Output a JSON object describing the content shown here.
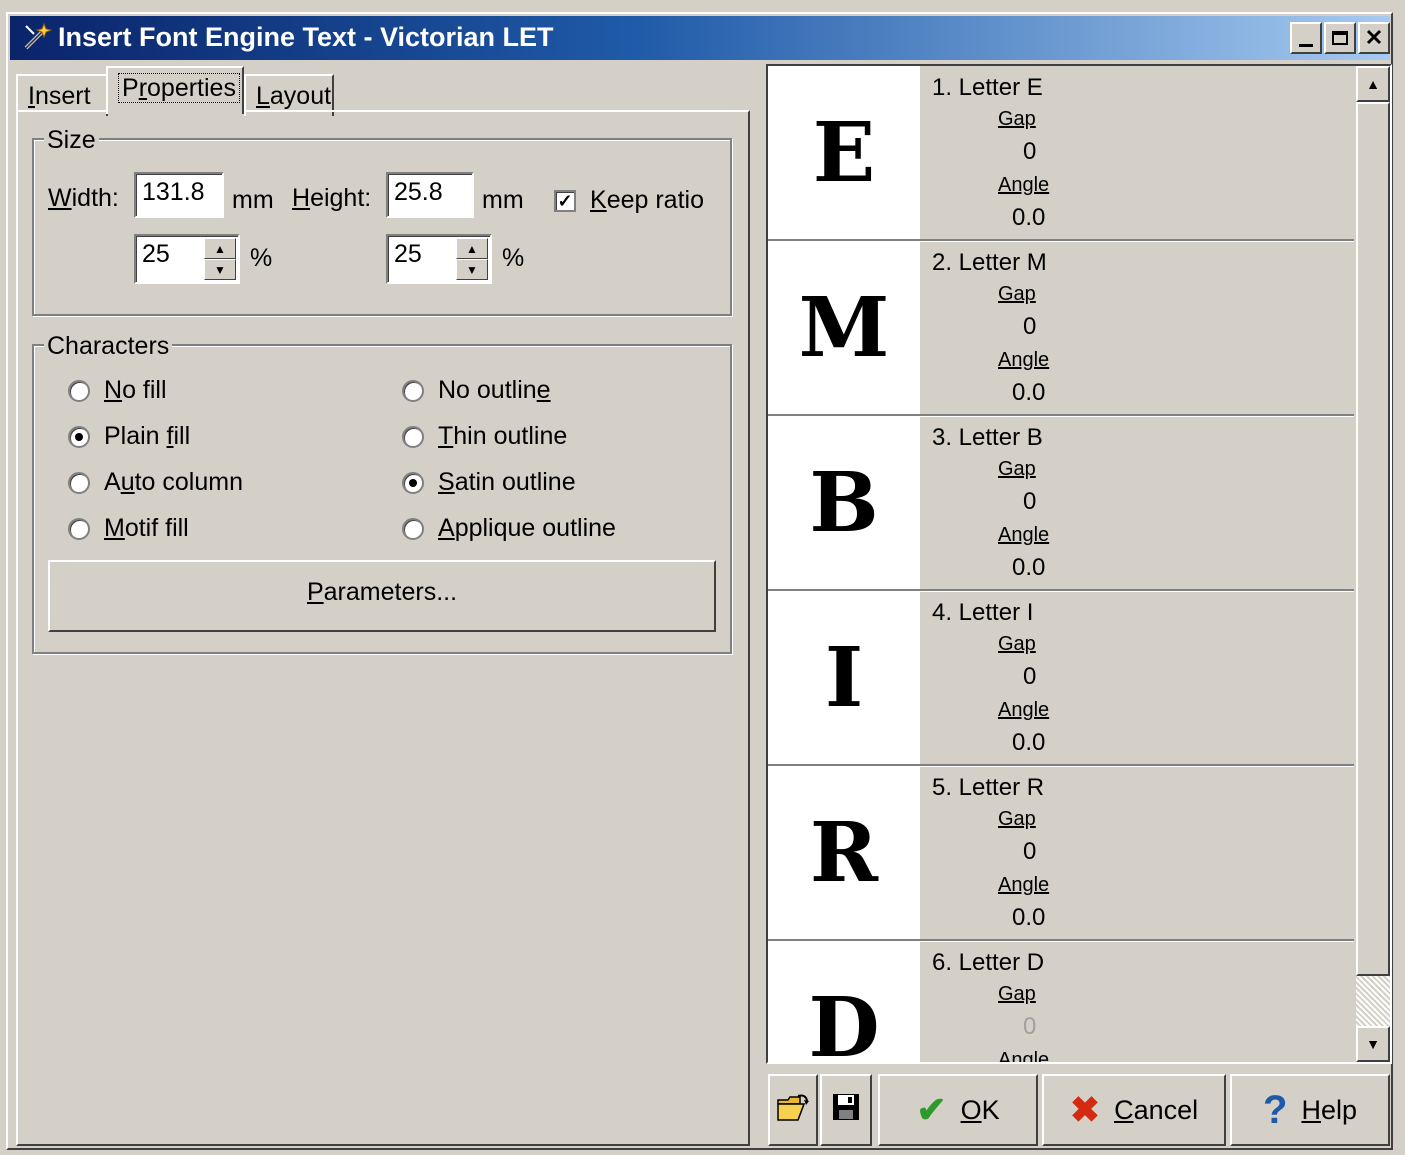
{
  "window": {
    "title": "Insert Font Engine Text - Victorian LET",
    "app_icon": "wand-icon",
    "minimize": "_",
    "maximize": "□",
    "close": "×"
  },
  "tabs": {
    "insert": {
      "prefix": "",
      "ul": "I",
      "rest": "nsert"
    },
    "properties": {
      "prefix": "P",
      "ul": "r",
      "rest": "operties"
    },
    "layout": {
      "prefix": "",
      "ul": "L",
      "rest": "ayout"
    },
    "active": "Properties"
  },
  "size": {
    "group_label": "Size",
    "width_label": {
      "ul": "W",
      "rest": "idth:"
    },
    "width_value": "131.8",
    "width_unit": "mm",
    "height_label": {
      "ul": "H",
      "rest": "eight:"
    },
    "height_value": "25.8",
    "height_unit": "mm",
    "keep_ratio": {
      "ul": "K",
      "rest": "eep ratio",
      "checked": true
    },
    "width_percent": "25",
    "height_percent": "25",
    "percent_sign": "%"
  },
  "characters": {
    "group_label": "Characters",
    "fill_options": [
      {
        "pre": "",
        "ul": "N",
        "post": "o fill",
        "selected": false
      },
      {
        "pre": "Plain ",
        "ul": "f",
        "post": "ill",
        "selected": true
      },
      {
        "pre": "A",
        "ul": "u",
        "post": "to column",
        "selected": false
      },
      {
        "pre": "",
        "ul": "M",
        "post": "otif fill",
        "selected": false
      }
    ],
    "outline_options": [
      {
        "pre": "No outlin",
        "ul": "e",
        "post": "",
        "selected": false
      },
      {
        "pre": "",
        "ul": "T",
        "post": "hin outline",
        "selected": false
      },
      {
        "pre": "",
        "ul": "S",
        "post": "atin outline",
        "selected": true
      },
      {
        "pre": "",
        "ul": "A",
        "post": "pplique outline",
        "selected": false
      }
    ],
    "parameters_button": {
      "ul": "P",
      "rest": "arameters..."
    }
  },
  "letters": [
    {
      "label": "1. Letter E",
      "glyph": "E",
      "gap_label": "Gap",
      "gap": "0",
      "angle_label": "Angle",
      "angle": "0.0"
    },
    {
      "label": "2. Letter M",
      "glyph": "M",
      "gap_label": "Gap",
      "gap": "0",
      "angle_label": "Angle",
      "angle": "0.0"
    },
    {
      "label": "3. Letter B",
      "glyph": "B",
      "gap_label": "Gap",
      "gap": "0",
      "angle_label": "Angle",
      "angle": "0.0"
    },
    {
      "label": "4. Letter I",
      "glyph": "I",
      "gap_label": "Gap",
      "gap": "0",
      "angle_label": "Angle",
      "angle": "0.0"
    },
    {
      "label": "5. Letter R",
      "glyph": "R",
      "gap_label": "Gap",
      "gap": "0",
      "angle_label": "Angle",
      "angle": "0.0"
    },
    {
      "label": "6. Letter D",
      "glyph": "D",
      "gap_label": "Gap",
      "gap": "0",
      "angle_label": "Angle",
      "angle": ""
    }
  ],
  "buttons": {
    "open_icon": "folder-open-icon",
    "save_icon": "floppy-disk-icon",
    "ok": {
      "ul": "O",
      "rest": "K"
    },
    "cancel": {
      "ul": "C",
      "rest": "ancel"
    },
    "help": {
      "ul": "H",
      "rest": "elp"
    }
  },
  "colors": {
    "titlebar_start": "#0a246a",
    "titlebar_end": "#a6caf0",
    "face": "#d4d0c8",
    "ok_check": "#2e9a2e",
    "cancel_x": "#d42a10",
    "help_q": "#1f5aa8"
  }
}
